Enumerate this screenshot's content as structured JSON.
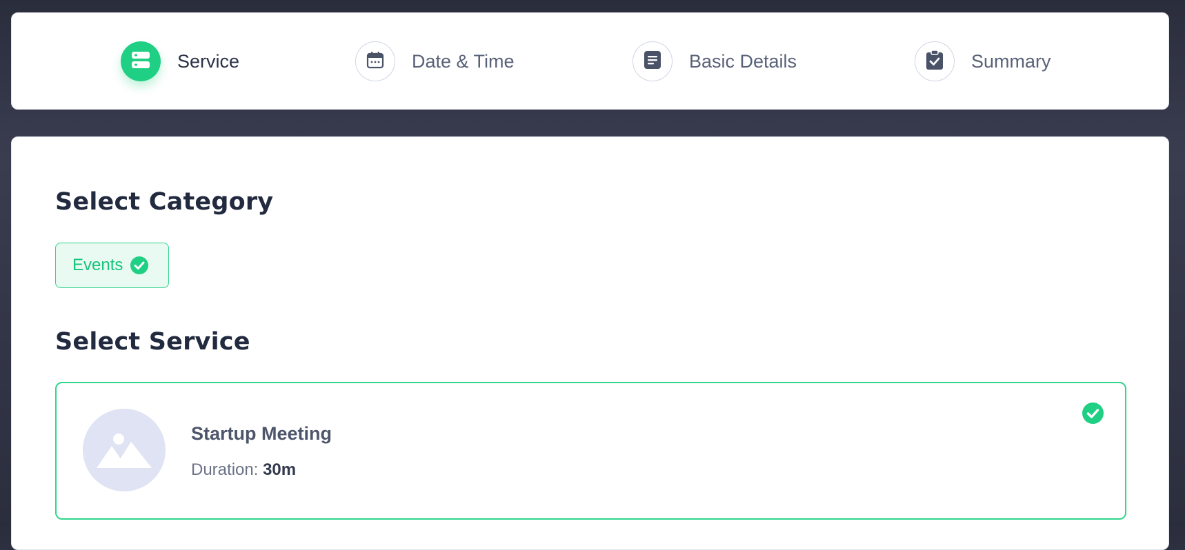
{
  "stepper": {
    "steps": [
      {
        "label": "Service",
        "icon": "server-icon",
        "active": true
      },
      {
        "label": "Date & Time",
        "icon": "calendar-icon",
        "active": false
      },
      {
        "label": "Basic Details",
        "icon": "document-icon",
        "active": false
      },
      {
        "label": "Summary",
        "icon": "clipboard-check-icon",
        "active": false
      }
    ]
  },
  "category_section": {
    "heading": "Select Category",
    "selected_category": {
      "label": "Events",
      "icon": "check-circle-icon"
    }
  },
  "service_section": {
    "heading": "Select Service",
    "selected_service": {
      "title": "Startup Meeting",
      "duration_label": "Duration:",
      "duration_value": "30m",
      "thumbnail_icon": "image-placeholder-icon",
      "selected_icon": "check-circle-icon"
    }
  },
  "colors": {
    "accent": "#1fcf83",
    "background": "#2e3142",
    "card": "#ffffff",
    "heading": "#222a3f",
    "chip_background": "#e8faf1"
  }
}
